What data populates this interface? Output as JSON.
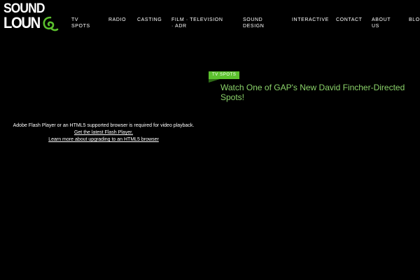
{
  "brand": {
    "line1": "SOUND",
    "line2": "LOUN",
    "accent_color": "#5cc12e"
  },
  "nav": {
    "items": [
      {
        "label": "TV SPOTS",
        "icon": ""
      },
      {
        "label": "RADIO"
      },
      {
        "label": "CASTING"
      },
      {
        "label": "FILM · TELEVISION · ADR"
      },
      {
        "label": "SOUND DESIGN"
      },
      {
        "label": "INTERACTIVE"
      },
      {
        "label": "CONTACT"
      },
      {
        "label": "ABOUT US"
      },
      {
        "label": "BLOG"
      }
    ]
  },
  "video": {
    "message": "Adobe Flash Player or an HTML5 supported browser is required for video playback.",
    "link_flash": "Get the latest Flash Player.",
    "link_html5": "Learn more about upgrading to an HTML5 browser"
  },
  "post": {
    "tag": "TV SPOTS",
    "title": "Watch One of GAP's New David Fincher-Directed Spots!",
    "title_color": "#8bd36a"
  }
}
